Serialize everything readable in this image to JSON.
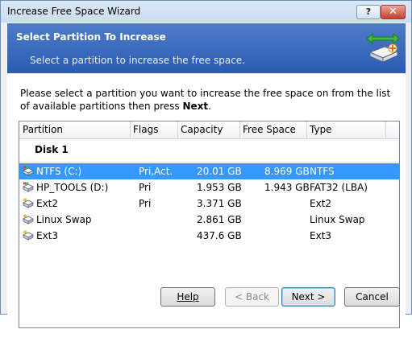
{
  "window": {
    "title": "Increase Free Space Wizard",
    "help_glyph": "?",
    "close_glyph": "✕"
  },
  "header": {
    "title": "Select Partition To Increase",
    "subtitle": "Select a partition to increase the free space."
  },
  "instructions": {
    "text": "Please select a partition you want to increase the free space on from the list of available partitions then press ",
    "bold": "Next",
    "end": "."
  },
  "columns": [
    "Partition",
    "Flags",
    "Capacity",
    "Free Space",
    "Type"
  ],
  "group": "Disk 1",
  "rows": [
    {
      "name": "NTFS (C:)",
      "flags": "Pri,Act.",
      "capacity": "20.01 GB",
      "free": "8.969 GB",
      "type": "NTFS",
      "selected": true,
      "icon": "drive-windows-icon"
    },
    {
      "name": "HP_TOOLS (D:)",
      "flags": "Pri",
      "capacity": "1.953 GB",
      "free": "1.943 GB",
      "type": "FAT32 (LBA)",
      "selected": false,
      "icon": "drive-windows-icon"
    },
    {
      "name": "Ext2",
      "flags": "Pri",
      "capacity": "3.371 GB",
      "free": "",
      "type": "Ext2",
      "selected": false,
      "icon": "drive-linux-icon"
    },
    {
      "name": "Linux Swap",
      "flags": "",
      "capacity": "2.861 GB",
      "free": "",
      "type": "Linux Swap",
      "selected": false,
      "icon": "drive-linux-icon"
    },
    {
      "name": "Ext3",
      "flags": "",
      "capacity": "437.6 GB",
      "free": "",
      "type": "Ext3",
      "selected": false,
      "icon": "drive-linux-icon"
    }
  ],
  "buttons": {
    "help": "Help",
    "back": "< Back",
    "next": "Next >",
    "cancel": "Cancel"
  },
  "colors": {
    "header": "#2a5bb3",
    "selection": "#3399ff"
  }
}
